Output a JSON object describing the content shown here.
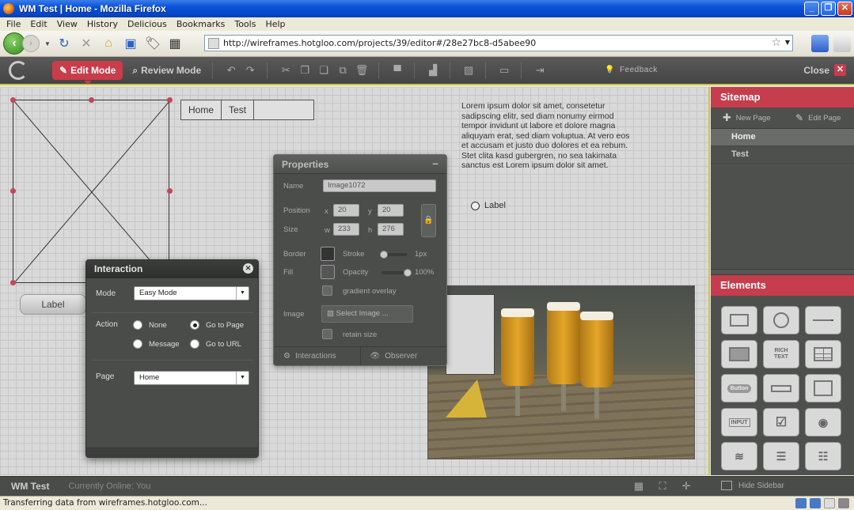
{
  "window": {
    "title": "WM Test | Home - Mozilla Firefox",
    "menu": [
      "File",
      "Edit",
      "View",
      "History",
      "Delicious",
      "Bookmarks",
      "Tools",
      "Help"
    ],
    "url": "http://wireframes.hotgloo.com/projects/39/editor#/28e27bc8-d5abee90",
    "status": "Transferring data from wireframes.hotgloo.com..."
  },
  "toolbar": {
    "edit_mode": "Edit Mode",
    "review_mode": "Review Mode",
    "feedback": "Feedback",
    "close": "Close"
  },
  "canvas": {
    "tabs": [
      "Home",
      "Test",
      ""
    ],
    "lorem": "Lorem ipsum dolor sit amet, consetetur sadipscing elitr, sed diam nonumy eirmod tempor invidunt ut labore et dolore magna aliquyam erat, sed diam voluptua. At vero eos et accusam et justo duo dolores et ea rebum. Stet clita kasd gubergren, no sea takimata sanctus est Lorem ipsum dolor sit amet.",
    "radio_label": "Label",
    "button_label": "Label"
  },
  "properties": {
    "title": "Properties",
    "name_label": "Name",
    "name_value": "Image1072",
    "position_label": "Position",
    "x_label": "x",
    "x_value": "20",
    "y_label": "y",
    "y_value": "20",
    "size_label": "Size",
    "w_label": "w",
    "w_value": "233",
    "h_label": "h",
    "h_value": "276",
    "border_label": "Border",
    "stroke_label": "Stroke",
    "stroke_value": "1px",
    "fill_label": "Fill",
    "opacity_label": "Opacity",
    "opacity_value": "100%",
    "gradient_label": "gradient overlay",
    "image_label": "Image",
    "select_image": "Select Image ...",
    "retain_label": "retain size",
    "interactions_tab": "Interactions",
    "observer_tab": "Observer",
    "border_color": "#333333",
    "fill_color": "#555555"
  },
  "interaction": {
    "title": "Interaction",
    "mode_label": "Mode",
    "mode_value": "Easy Mode",
    "action_label": "Action",
    "opt_none": "None",
    "opt_goto_page": "Go to Page",
    "opt_message": "Message",
    "opt_goto_url": "Go to URL",
    "page_label": "Page",
    "page_value": "Home",
    "selected_action": "Go to Page"
  },
  "sidebar": {
    "sitemap_title": "Sitemap",
    "new_page": "New Page",
    "edit_page": "Edit Page",
    "pages": [
      "Home",
      "Test"
    ],
    "elements_title": "Elements",
    "element_labels": {
      "rich_text": "RICH TEXT",
      "button": "Button",
      "input": "INPUT"
    }
  },
  "footer": {
    "project": "WM Test",
    "online": "Currently Online: You",
    "hide_sidebar": "Hide Sidebar"
  },
  "colors": {
    "accent": "#c63d4d",
    "highlight": "#c7c74a"
  }
}
